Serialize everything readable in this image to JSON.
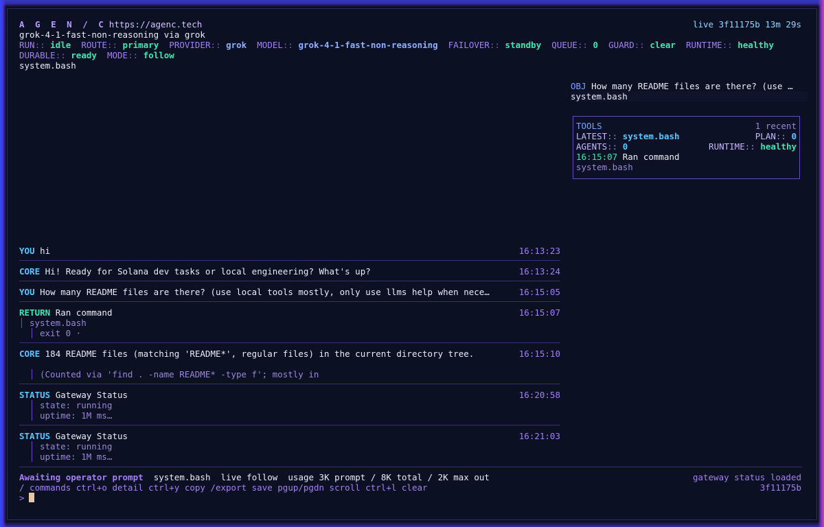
{
  "header": {
    "brand": "A G E N / C",
    "url": "https://agenc.tech",
    "live": "live 3f11175b 13m 29s",
    "model_line": "grok-4-1-fast-non-reasoning via grok",
    "status": [
      {
        "key": "RUN",
        "value": "idle"
      },
      {
        "key": "ROUTE",
        "value": "primary"
      },
      {
        "key": "PROVIDER",
        "value": "grok"
      },
      {
        "key": "MODEL",
        "value": "grok-4-1-fast-non-reasoning"
      },
      {
        "key": "FAILOVER",
        "value": "standby"
      },
      {
        "key": "QUEUE",
        "value": "0"
      },
      {
        "key": "GUARD",
        "value": "clear"
      },
      {
        "key": "RUNTIME",
        "value": "healthy"
      }
    ],
    "status2": [
      {
        "key": "DURABLE",
        "value": "ready"
      },
      {
        "key": "MODE",
        "value": "follow"
      }
    ],
    "system_line": "system.bash"
  },
  "objective": {
    "label": "OBJ",
    "text": "How many README files are there? (use …",
    "sub": "system.bash"
  },
  "tools": {
    "title": "TOOLS",
    "recent": "1 recent",
    "latest_key": "LATEST",
    "latest_value": "system.bash",
    "plan_key": "PLAN",
    "plan_value": "0",
    "agents_key": "AGENTS",
    "agents_value": "0",
    "runtime_key": "RUNTIME",
    "runtime_value": "healthy",
    "event_time": "16:15:07",
    "event_text": "Ran command",
    "event_sub": "system.bash"
  },
  "messages": [
    {
      "role": "YOU",
      "text": "hi",
      "time": "16:13:23"
    },
    {
      "role": "CORE",
      "text": "Hi! Ready for Solana dev tasks or local engineering? What's up?",
      "time": "16:13:24"
    },
    {
      "role": "YOU",
      "text": "How many README files are there? (use local tools mostly, only use llms help when nece…",
      "time": "16:15:05"
    },
    {
      "role": "RETURN",
      "text": "Ran command",
      "time": "16:15:07",
      "sub1": "system.bash",
      "sub2": "exit 0 ·"
    },
    {
      "role": "CORE",
      "text": "184 README files (matching 'README*', regular files) in the current directory tree.",
      "time": "16:15:10",
      "sub1": "(Counted via 'find . -name README* -type f'; mostly in"
    },
    {
      "role": "STATUS",
      "text": "Gateway Status",
      "time": "16:20:58",
      "sub1": "state: running",
      "sub2": "uptime: 1M ms…"
    },
    {
      "role": "STATUS",
      "text": "Gateway Status",
      "time": "16:21:03",
      "sub1": "state: running",
      "sub2": "uptime: 1M ms…"
    }
  ],
  "footer": {
    "awaiting": "Awaiting operator prompt",
    "tool": "system.bash",
    "mode": "live follow",
    "usage": "usage 3K prompt / 8K total / 2K max out",
    "hints": "/ commands  ctrl+o detail  ctrl+y copy  /export save  pgup/pgdn scroll  ctrl+l clear",
    "right1": "gateway status loaded",
    "right2": "3f11175b",
    "prompt": ">"
  },
  "colors": {
    "you": "#58c7ff",
    "core": "#58c7ff",
    "return": "#3ee7b2",
    "status": "#58c7ff",
    "accent": "#a57ff6"
  }
}
